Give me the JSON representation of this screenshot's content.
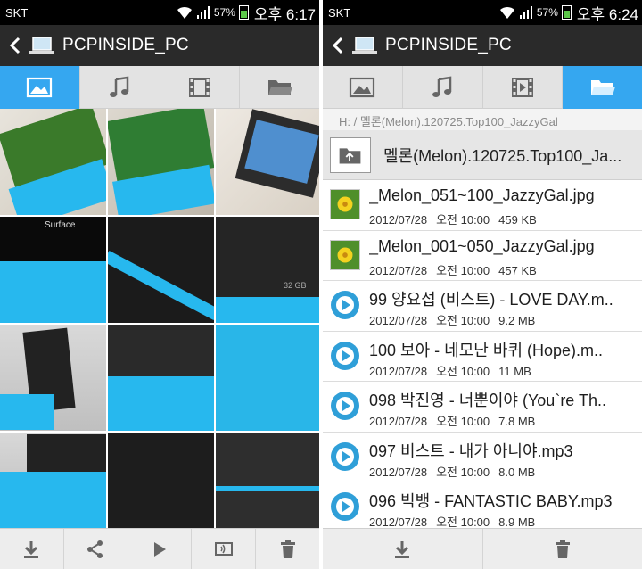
{
  "left": {
    "status": {
      "carrier": "SKT",
      "battery": "57%",
      "time": "오후 6:17"
    },
    "title": "PCPINSIDE_PC",
    "tabs": [
      {
        "icon": "image-icon",
        "active": true
      },
      {
        "icon": "music-icon",
        "active": false
      },
      {
        "icon": "film-icon",
        "active": false
      },
      {
        "icon": "folder-icon",
        "active": false
      }
    ],
    "photos": [
      {
        "label": ""
      },
      {
        "label": ""
      },
      {
        "label": ""
      },
      {
        "label": "Surface"
      },
      {
        "label": ""
      },
      {
        "label": "32 GB"
      },
      {
        "label": ""
      },
      {
        "label": ""
      },
      {
        "label": ""
      },
      {
        "label": ""
      },
      {
        "label": ""
      },
      {
        "label": ""
      }
    ],
    "bottom": [
      "download-icon",
      "share-icon",
      "play-icon",
      "cast-icon",
      "trash-icon"
    ]
  },
  "right": {
    "status": {
      "carrier": "SKT",
      "battery": "57%",
      "time": "오후 6:24"
    },
    "title": "PCPINSIDE_PC",
    "path": "H: / 멜론(Melon).120725.Top100_JazzyGal",
    "parent_folder": "멜론(Melon).120725.Top100_Ja...",
    "files": [
      {
        "name": "_Melon_051~100_JazzyGal.jpg",
        "date": "2012/07/28",
        "time": "오전 10:00",
        "size": "459 KB",
        "type": "image"
      },
      {
        "name": "_Melon_001~050_JazzyGal.jpg",
        "date": "2012/07/28",
        "time": "오전 10:00",
        "size": "457 KB",
        "type": "image"
      },
      {
        "name": "99 양요섭 (비스트) - LOVE DAY.m..",
        "date": "2012/07/28",
        "time": "오전 10:00",
        "size": "9.2 MB",
        "type": "audio"
      },
      {
        "name": "100 보아 - 네모난 바퀴 (Hope).m..",
        "date": "2012/07/28",
        "time": "오전 10:00",
        "size": "11 MB",
        "type": "audio"
      },
      {
        "name": "098 박진영 - 너뿐이야 (You`re Th..",
        "date": "2012/07/28",
        "time": "오전 10:00",
        "size": "7.8 MB",
        "type": "audio"
      },
      {
        "name": "097 비스트 - 내가 아니야.mp3",
        "date": "2012/07/28",
        "time": "오전 10:00",
        "size": "8.0 MB",
        "type": "audio"
      },
      {
        "name": "096 빅뱅 - FANTASTIC BABY.mp3",
        "date": "2012/07/28",
        "time": "오전 10:00",
        "size": "8.9 MB",
        "type": "audio"
      }
    ],
    "bottom": [
      "download-icon",
      "trash-icon"
    ]
  },
  "colors": {
    "accent": "#35a7f0",
    "keyboard": "#27b8ee"
  }
}
